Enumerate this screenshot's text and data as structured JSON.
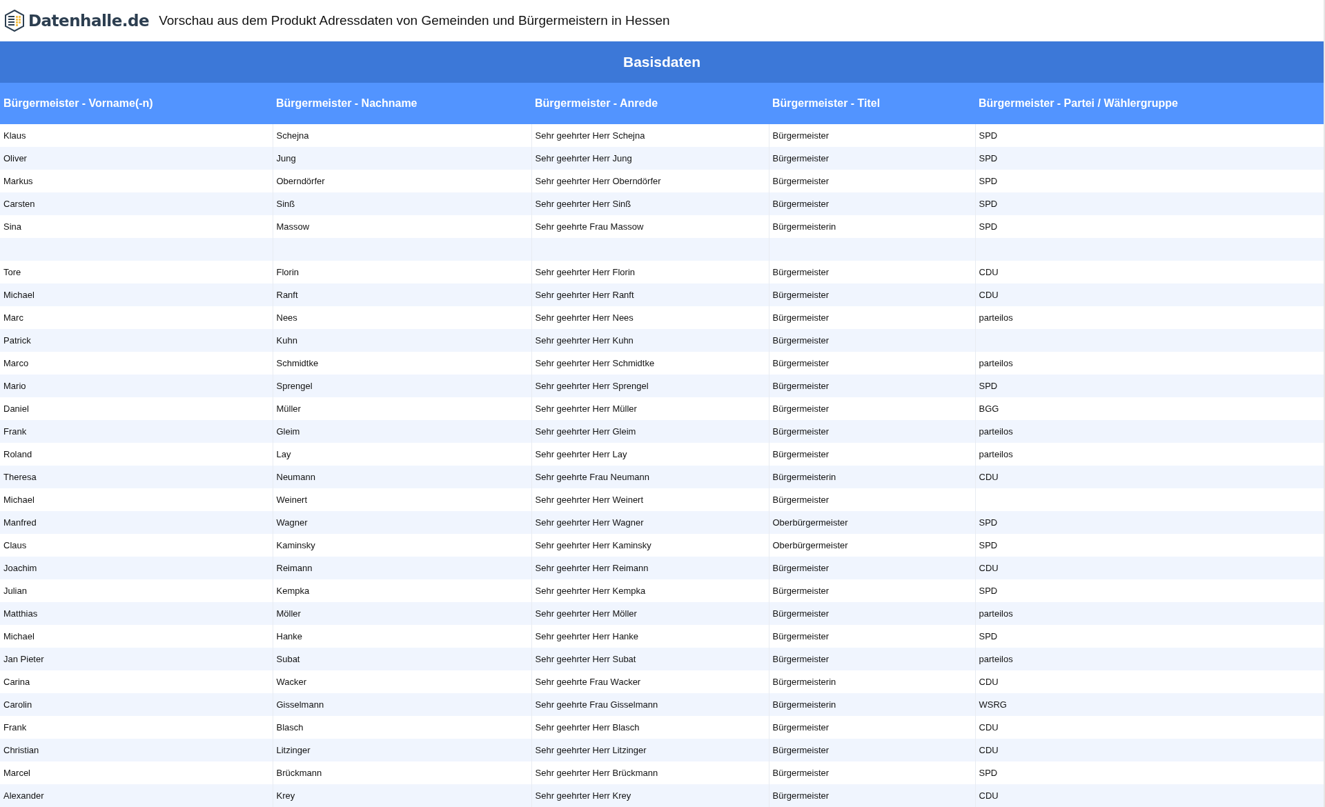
{
  "header": {
    "logo_text": "Datenhalle.de",
    "title": "Vorschau aus dem Produkt Adressdaten von Gemeinden und Bürgermeistern in Hessen"
  },
  "table": {
    "section_title": "Basisdaten",
    "columns": [
      "Bürgermeister - Vorname(-n)",
      "Bürgermeister - Nachname",
      "Bürgermeister - Anrede",
      "Bürgermeister - Titel",
      "Bürgermeister - Partei / Wählergruppe"
    ],
    "rows": [
      {
        "first_name": "Klaus",
        "last_name": "Schejna",
        "salutation": "Sehr geehrter Herr Schejna",
        "title": "Bürgermeister",
        "party": "SPD"
      },
      {
        "first_name": "Oliver",
        "last_name": "Jung",
        "salutation": "Sehr geehrter Herr Jung",
        "title": "Bürgermeister",
        "party": "SPD"
      },
      {
        "first_name": "Markus",
        "last_name": "Oberndörfer",
        "salutation": "Sehr geehrter Herr Oberndörfer",
        "title": "Bürgermeister",
        "party": "SPD"
      },
      {
        "first_name": "Carsten",
        "last_name": "Sinß",
        "salutation": "Sehr geehrter Herr Sinß",
        "title": "Bürgermeister",
        "party": "SPD"
      },
      {
        "first_name": "Sina",
        "last_name": "Massow",
        "salutation": "Sehr geehrte Frau Massow",
        "title": "Bürgermeisterin",
        "party": "SPD"
      },
      {},
      {
        "first_name": "Tore",
        "last_name": "Florin",
        "salutation": "Sehr geehrter Herr Florin",
        "title": "Bürgermeister",
        "party": "CDU"
      },
      {
        "first_name": "Michael",
        "last_name": "Ranft",
        "salutation": "Sehr geehrter Herr Ranft",
        "title": "Bürgermeister",
        "party": "CDU"
      },
      {
        "first_name": "Marc",
        "last_name": "Nees",
        "salutation": "Sehr geehrter Herr Nees",
        "title": "Bürgermeister",
        "party": "parteilos"
      },
      {
        "first_name": "Patrick",
        "last_name": "Kuhn",
        "salutation": "Sehr geehrter Herr Kuhn",
        "title": "Bürgermeister"
      },
      {
        "first_name": "Marco",
        "last_name": "Schmidtke",
        "salutation": "Sehr geehrter Herr Schmidtke",
        "title": "Bürgermeister",
        "party": "parteilos"
      },
      {
        "first_name": "Mario",
        "last_name": "Sprengel",
        "salutation": "Sehr geehrter Herr Sprengel",
        "title": "Bürgermeister",
        "party": "SPD"
      },
      {
        "first_name": "Daniel",
        "last_name": "Müller",
        "salutation": "Sehr geehrter Herr Müller",
        "title": "Bürgermeister",
        "party": "BGG"
      },
      {
        "first_name": "Frank",
        "last_name": "Gleim",
        "salutation": "Sehr geehrter Herr Gleim",
        "title": "Bürgermeister",
        "party": "parteilos"
      },
      {
        "first_name": "Roland",
        "last_name": "Lay",
        "salutation": "Sehr geehrter Herr Lay",
        "title": "Bürgermeister",
        "party": "parteilos"
      },
      {
        "first_name": "Theresa",
        "last_name": "Neumann",
        "salutation": "Sehr geehrte Frau Neumann",
        "title": "Bürgermeisterin",
        "party": "CDU"
      },
      {
        "first_name": "Michael",
        "last_name": "Weinert",
        "salutation": "Sehr geehrter Herr Weinert",
        "title": "Bürgermeister"
      },
      {
        "first_name": "Manfred",
        "last_name": "Wagner",
        "salutation": "Sehr geehrter Herr Wagner",
        "title": "Oberbürgermeister",
        "party": "SPD"
      },
      {
        "first_name": "Claus",
        "last_name": "Kaminsky",
        "salutation": "Sehr geehrter Herr Kaminsky",
        "title": "Oberbürgermeister",
        "party": "SPD"
      },
      {
        "first_name": "Joachim",
        "last_name": "Reimann",
        "salutation": "Sehr geehrter Herr Reimann",
        "title": "Bürgermeister",
        "party": "CDU"
      },
      {
        "first_name": "Julian",
        "last_name": "Kempka",
        "salutation": "Sehr geehrter Herr Kempka",
        "title": "Bürgermeister",
        "party": "SPD"
      },
      {
        "first_name": "Matthias",
        "last_name": "Möller",
        "salutation": "Sehr geehrter Herr Möller",
        "title": "Bürgermeister",
        "party": "parteilos"
      },
      {
        "first_name": "Michael",
        "last_name": "Hanke",
        "salutation": "Sehr geehrter Herr Hanke",
        "title": "Bürgermeister",
        "party": "SPD"
      },
      {
        "first_name": "Jan Pieter",
        "last_name": "Subat",
        "salutation": "Sehr geehrter Herr Subat",
        "title": "Bürgermeister",
        "party": "parteilos"
      },
      {
        "first_name": "Carina",
        "last_name": "Wacker",
        "salutation": "Sehr geehrte Frau Wacker",
        "title": "Bürgermeisterin",
        "party": "CDU"
      },
      {
        "first_name": "Carolin",
        "last_name": "Gisselmann",
        "salutation": "Sehr geehrte Frau Gisselmann",
        "title": "Bürgermeisterin",
        "party": "WSRG"
      },
      {
        "first_name": "Frank",
        "last_name": "Blasch",
        "salutation": "Sehr geehrter Herr Blasch",
        "title": "Bürgermeister",
        "party": "CDU"
      },
      {
        "first_name": "Christian",
        "last_name": "Litzinger",
        "salutation": "Sehr geehrter Herr Litzinger",
        "title": "Bürgermeister",
        "party": "CDU"
      },
      {
        "first_name": "Marcel",
        "last_name": "Brückmann",
        "salutation": "Sehr geehrter Herr Brückmann",
        "title": "Bürgermeister",
        "party": "SPD"
      },
      {
        "first_name": "Alexander",
        "last_name": "Krey",
        "salutation": "Sehr geehrter Herr Krey",
        "title": "Bürgermeister",
        "party": "CDU"
      }
    ]
  }
}
